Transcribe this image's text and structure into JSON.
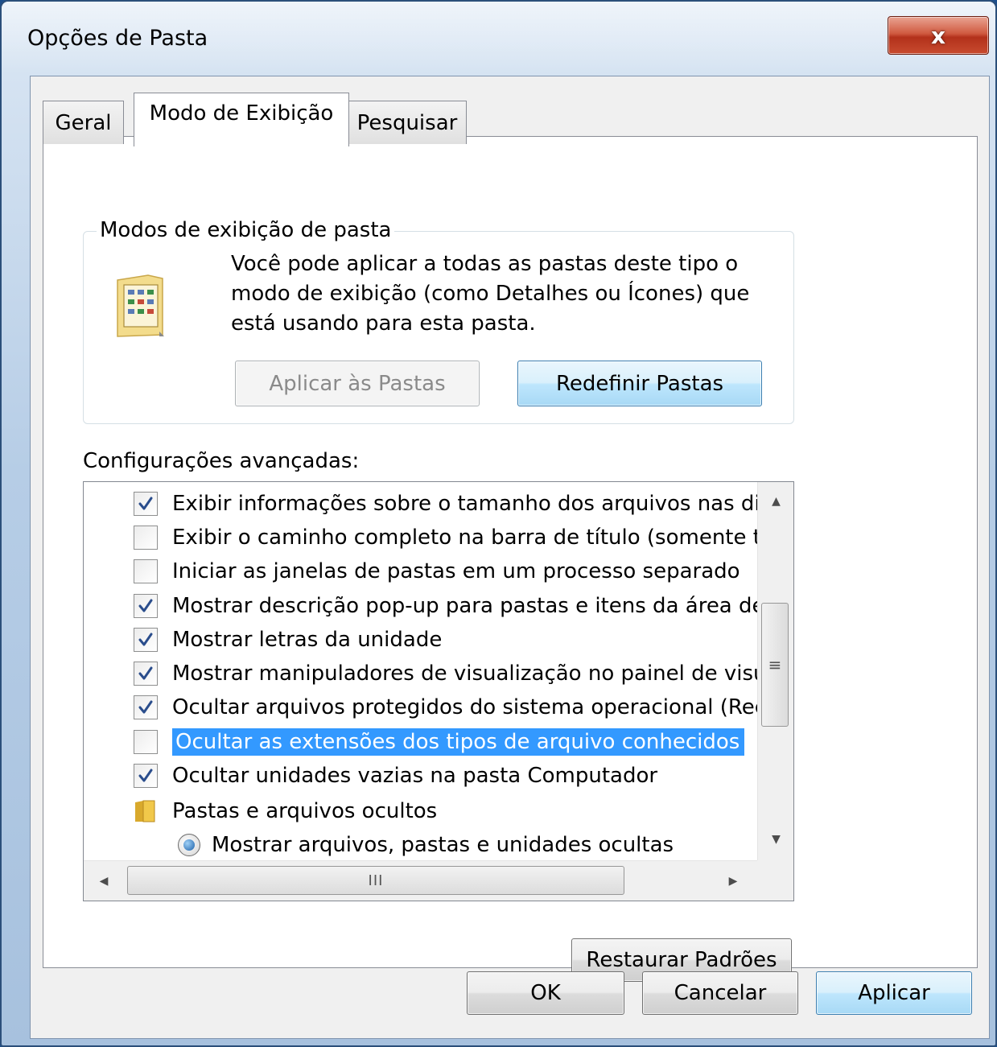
{
  "window": {
    "title": "Opções de Pasta",
    "close_label": "x"
  },
  "tabs": [
    {
      "label": "Geral"
    },
    {
      "label": "Modo de Exibição"
    },
    {
      "label": "Pesquisar"
    }
  ],
  "folder_views": {
    "title": "Modos de exibição de pasta",
    "description": "Você pode aplicar a todas as pastas deste tipo o modo de exibição (como Detalhes ou Ícones) que está usando para esta pasta.",
    "apply_button": "Aplicar às Pastas",
    "reset_button": "Redefinir Pastas"
  },
  "advanced": {
    "label": "Configurações avançadas:",
    "items": [
      {
        "type": "checkbox",
        "checked": true,
        "label": "Exibir informações sobre o tamanho dos arquivos nas dicas de pasta"
      },
      {
        "type": "checkbox",
        "checked": false,
        "label": "Exibir o caminho completo na barra de título (somente temas Clássicos)"
      },
      {
        "type": "checkbox",
        "checked": false,
        "label": "Iniciar as janelas de pastas em um processo separado"
      },
      {
        "type": "checkbox",
        "checked": true,
        "label": "Mostrar descrição pop-up para pastas e itens da área de trabalho"
      },
      {
        "type": "checkbox",
        "checked": true,
        "label": "Mostrar letras da unidade"
      },
      {
        "type": "checkbox",
        "checked": true,
        "label": "Mostrar manipuladores de visualização no painel de visualização"
      },
      {
        "type": "checkbox",
        "checked": true,
        "label": "Ocultar arquivos protegidos do sistema operacional (Recomendado)"
      },
      {
        "type": "checkbox",
        "checked": false,
        "selected": true,
        "label": "Ocultar as extensões dos tipos de arquivo conhecidos"
      },
      {
        "type": "checkbox",
        "checked": true,
        "label": "Ocultar unidades vazias na pasta Computador"
      },
      {
        "type": "folder",
        "label": "Pastas e arquivos ocultos"
      },
      {
        "type": "radio",
        "checked": true,
        "label": "Mostrar arquivos, pastas e unidades ocultas"
      }
    ],
    "hscroll_grip": "III"
  },
  "restore_button": "Restaurar Padrões",
  "footer": {
    "ok": "OK",
    "cancel": "Cancelar",
    "apply": "Aplicar"
  },
  "colors": {
    "selection": "#3399ff",
    "close_button": "#c84b2f",
    "window_frame": "#a7c1de"
  }
}
